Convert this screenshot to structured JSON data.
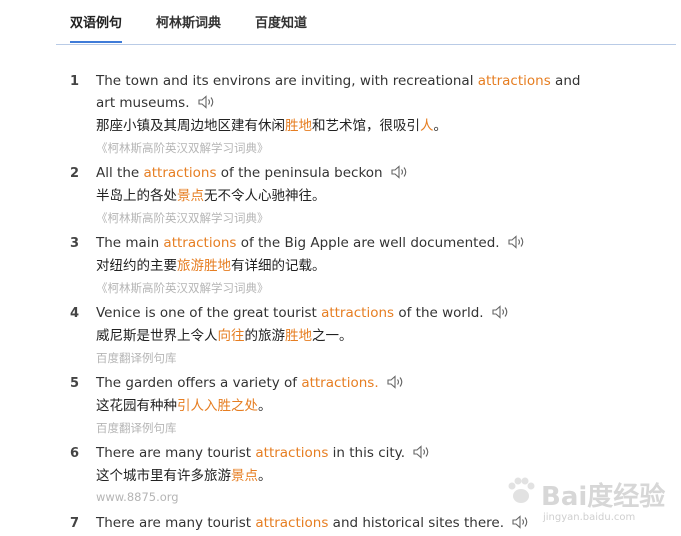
{
  "tabs": [
    {
      "label": "双语例句",
      "active": true
    },
    {
      "label": "柯林斯词典",
      "active": false
    },
    {
      "label": "百度知道",
      "active": false
    }
  ],
  "examples": [
    {
      "num": "1",
      "en": [
        {
          "t": "The town and its environs are inviting, with recreational "
        },
        {
          "t": "attractions",
          "hl": true
        },
        {
          "t": " and art museums."
        }
      ],
      "zh": [
        {
          "t": "那座小镇及其周边地区建有休闲"
        },
        {
          "t": "胜地",
          "hl": true
        },
        {
          "t": "和艺术馆，很吸引"
        },
        {
          "t": "人",
          "hl": true
        },
        {
          "t": "。"
        }
      ],
      "source": "《柯林斯高阶英汉双解学习词典》"
    },
    {
      "num": "2",
      "en": [
        {
          "t": "All the "
        },
        {
          "t": "attractions",
          "hl": true
        },
        {
          "t": " of the peninsula beckon"
        }
      ],
      "zh": [
        {
          "t": "半岛上的各处"
        },
        {
          "t": "景点",
          "hl": true
        },
        {
          "t": "无不令人心驰神往。"
        }
      ],
      "source": "《柯林斯高阶英汉双解学习词典》"
    },
    {
      "num": "3",
      "en": [
        {
          "t": "The main "
        },
        {
          "t": "attractions",
          "hl": true
        },
        {
          "t": " of the Big Apple are well documented."
        }
      ],
      "zh": [
        {
          "t": "对纽约的主要"
        },
        {
          "t": "旅游胜地",
          "hl": true
        },
        {
          "t": "有详细的记载。"
        }
      ],
      "source": "《柯林斯高阶英汉双解学习词典》"
    },
    {
      "num": "4",
      "en": [
        {
          "t": "Venice is one of the great tourist "
        },
        {
          "t": "attractions",
          "hl": true
        },
        {
          "t": " of the world."
        }
      ],
      "zh": [
        {
          "t": "威尼斯是世界上令人"
        },
        {
          "t": "向往",
          "hl": true
        },
        {
          "t": "的旅游"
        },
        {
          "t": "胜地",
          "hl": true
        },
        {
          "t": "之一。"
        }
      ],
      "source": "百度翻译例句库"
    },
    {
      "num": "5",
      "en": [
        {
          "t": "The garden offers a variety of "
        },
        {
          "t": "attractions.",
          "hl": true
        }
      ],
      "zh": [
        {
          "t": "这花园有种种"
        },
        {
          "t": "引人入胜之处",
          "hl": true
        },
        {
          "t": "。"
        }
      ],
      "source": "百度翻译例句库"
    },
    {
      "num": "6",
      "en": [
        {
          "t": "There are many tourist "
        },
        {
          "t": "attractions",
          "hl": true
        },
        {
          "t": " in this city."
        }
      ],
      "zh": [
        {
          "t": "这个城市里有许多旅游"
        },
        {
          "t": "景点",
          "hl": true
        },
        {
          "t": "。"
        }
      ],
      "source": "www.8875.org"
    },
    {
      "num": "7",
      "en": [
        {
          "t": "There are many tourist "
        },
        {
          "t": "attractions",
          "hl": true
        },
        {
          "t": " and historical sites there."
        }
      ],
      "zh": [],
      "source": ""
    }
  ],
  "watermark": {
    "text": "Bai度经验",
    "sub": "jingyan.baidu.com"
  },
  "colors": {
    "highlight": "#e67e22",
    "tab_underline": "#3f7bd8",
    "source_text": "#b5b5b5"
  }
}
